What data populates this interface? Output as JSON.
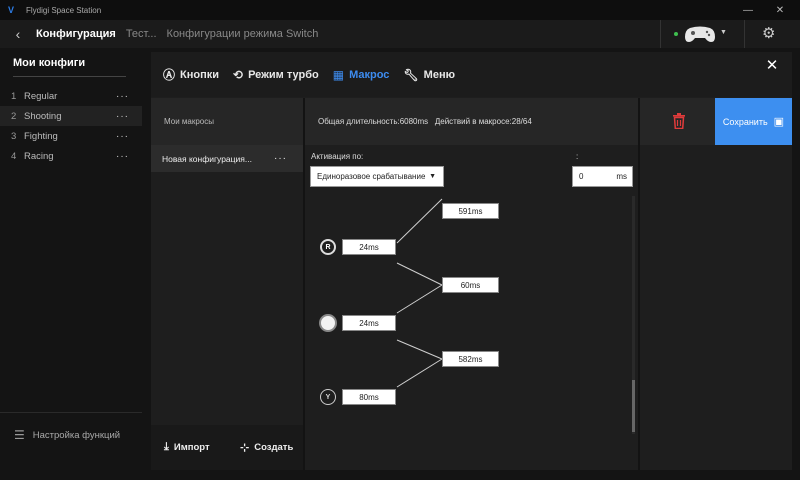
{
  "app": {
    "title": "Flydigi Space Station"
  },
  "breadcrumbs": [
    "Конфигурация",
    "Тест...",
    "Конфигурации режима Switch"
  ],
  "sidebar": {
    "title": "Мои конфиги",
    "items": [
      {
        "num": "1",
        "label": "Regular"
      },
      {
        "num": "2",
        "label": "Shooting"
      },
      {
        "num": "3",
        "label": "Fighting"
      },
      {
        "num": "4",
        "label": "Racing"
      }
    ],
    "more": "···",
    "func_label": "Настройка функций"
  },
  "tabs": [
    {
      "label": "Кнопки",
      "icon": "a-button-icon"
    },
    {
      "label": "Режим турбо",
      "icon": "turbo-icon"
    },
    {
      "label": "Макрос",
      "icon": "macro-icon"
    },
    {
      "label": "Меню",
      "icon": "wrench-icon"
    }
  ],
  "macro": {
    "my_macros": "Мои макросы",
    "duration": "Общая длительность:6080ms",
    "actions": "Действий в макросе:28/64",
    "save_label": "Сохранить",
    "item_label": "Новая конфигурация...",
    "import_label": "Импорт",
    "create_label": "Создать",
    "activation_label": "Активация по:",
    "colon": ":",
    "activation_value": "Единоразовое срабатывание",
    "ms_value": "0",
    "ms_unit": "ms"
  },
  "timeline": {
    "presses": [
      {
        "button": "R",
        "duration": "24ms"
      },
      {
        "button": "",
        "duration": "24ms"
      },
      {
        "button": "Y",
        "duration": "80ms"
      }
    ],
    "gaps": [
      "591ms",
      "60ms",
      "582ms"
    ]
  },
  "colors": {
    "accent": "#3d8ff0",
    "trash": "#e03b3b"
  }
}
